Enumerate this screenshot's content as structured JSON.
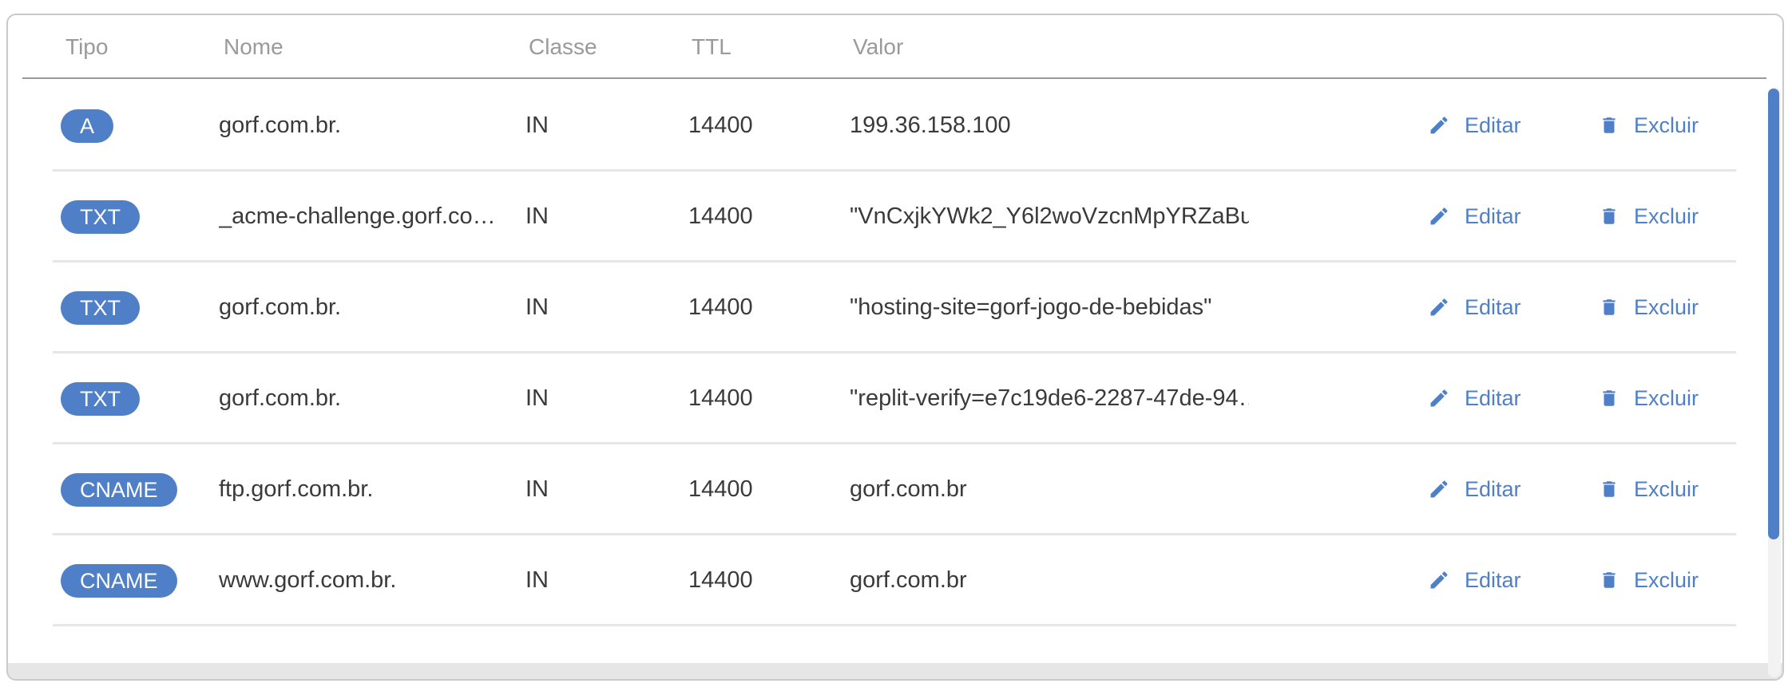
{
  "columns": {
    "tipo": "Tipo",
    "nome": "Nome",
    "classe": "Classe",
    "ttl": "TTL",
    "valor": "Valor"
  },
  "actions": {
    "edit_label": "Editar",
    "delete_label": "Excluir",
    "edit_icon": "pencil-icon",
    "delete_icon": "trash-icon"
  },
  "colors": {
    "accent": "#4f7fc6",
    "header_text": "#9a9a9a",
    "row_divider": "#e6e6e6"
  },
  "records": [
    {
      "type": "A",
      "name": "gorf.com.br.",
      "class": "IN",
      "ttl": "14400",
      "value": "199.36.158.100"
    },
    {
      "type": "TXT",
      "name": "_acme-challenge.gorf.co…",
      "class": "IN",
      "ttl": "14400",
      "value": "\"VnCxjkYWk2_Y6l2woVzcnMpYRZaBu…"
    },
    {
      "type": "TXT",
      "name": "gorf.com.br.",
      "class": "IN",
      "ttl": "14400",
      "value": "\"hosting-site=gorf-jogo-de-bebidas\""
    },
    {
      "type": "TXT",
      "name": "gorf.com.br.",
      "class": "IN",
      "ttl": "14400",
      "value": "\"replit-verify=e7c19de6-2287-47de-94…"
    },
    {
      "type": "CNAME",
      "name": "ftp.gorf.com.br.",
      "class": "IN",
      "ttl": "14400",
      "value": "gorf.com.br"
    },
    {
      "type": "CNAME",
      "name": "www.gorf.com.br.",
      "class": "IN",
      "ttl": "14400",
      "value": "gorf.com.br"
    }
  ]
}
